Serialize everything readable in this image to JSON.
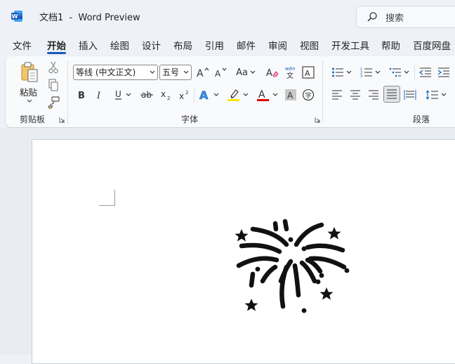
{
  "app": {
    "title": "文档1  -  Word Preview",
    "search_label": "搜索",
    "brand_color": "#185abd"
  },
  "tabs": [
    {
      "label": "文件"
    },
    {
      "label": "开始",
      "active": true
    },
    {
      "label": "插入"
    },
    {
      "label": "绘图"
    },
    {
      "label": "设计"
    },
    {
      "label": "布局"
    },
    {
      "label": "引用"
    },
    {
      "label": "邮件"
    },
    {
      "label": "审阅"
    },
    {
      "label": "视图"
    },
    {
      "label": "开发工具"
    },
    {
      "label": "帮助"
    },
    {
      "label": "百度网盘"
    }
  ],
  "clipboard": {
    "group_label": "剪贴板",
    "paste_label": "粘贴"
  },
  "font": {
    "group_label": "字体",
    "font_name": "等线 (中文正文)",
    "font_size": "五号",
    "aa_label": "Aa",
    "highlight_color": "#ffe400",
    "font_color": "#e00000"
  },
  "paragraph": {
    "group_label": "段落"
  },
  "document": {
    "image_icon": "fireworks-icon"
  }
}
